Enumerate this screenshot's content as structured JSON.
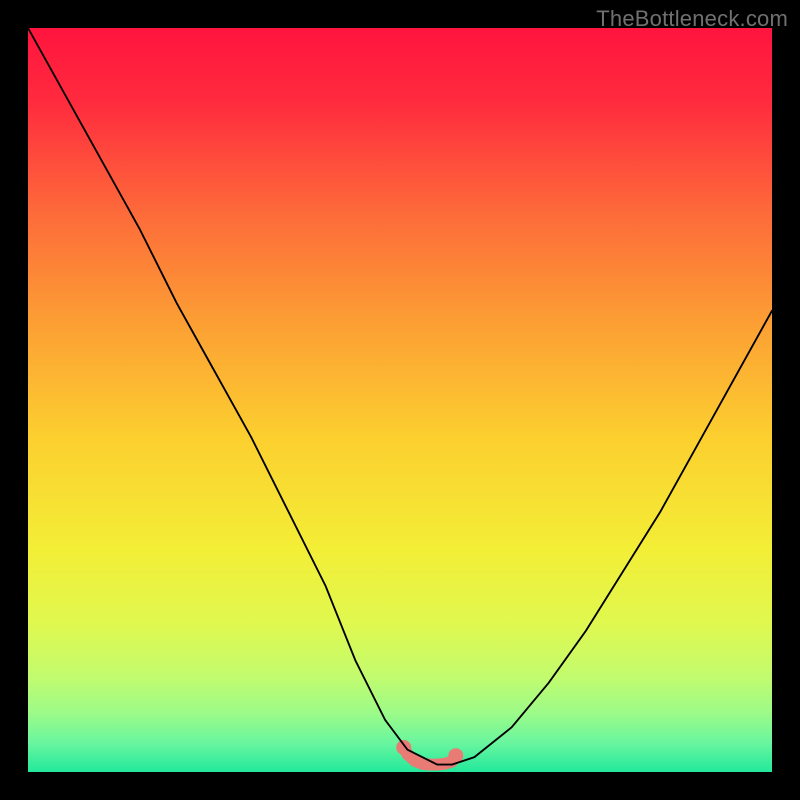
{
  "watermark": "TheBottleneck.com",
  "chart_data": {
    "type": "line",
    "title": "",
    "xlabel": "",
    "ylabel": "",
    "xlim": [
      0,
      100
    ],
    "ylim": [
      0,
      100
    ],
    "grid": false,
    "legend": false,
    "series": [
      {
        "name": "curve",
        "color": "#000000",
        "x": [
          0,
          5,
          10,
          15,
          20,
          25,
          30,
          35,
          40,
          44,
          48,
          51,
          55,
          57,
          60,
          65,
          70,
          75,
          80,
          85,
          90,
          95,
          100
        ],
        "values": [
          100,
          91,
          82,
          73,
          63,
          54,
          45,
          35,
          25,
          15,
          7,
          3,
          1,
          1,
          2,
          6,
          12,
          19,
          27,
          35,
          44,
          53,
          62
        ]
      },
      {
        "name": "threshold-band",
        "color": "#e87b74",
        "x": [
          50.5,
          51,
          52,
          53,
          54,
          55,
          56,
          57,
          57.5
        ],
        "values": [
          3.3,
          2.4,
          1.5,
          1.1,
          1.0,
          1.0,
          1.1,
          1.4,
          2.2
        ]
      }
    ],
    "gradient_stops": [
      {
        "pos": 0.0,
        "color": "#ff143e"
      },
      {
        "pos": 0.1,
        "color": "#ff2b3e"
      },
      {
        "pos": 0.25,
        "color": "#fd6b3a"
      },
      {
        "pos": 0.4,
        "color": "#fca034"
      },
      {
        "pos": 0.55,
        "color": "#fccf2f"
      },
      {
        "pos": 0.7,
        "color": "#f3ee36"
      },
      {
        "pos": 0.8,
        "color": "#e0f84f"
      },
      {
        "pos": 0.87,
        "color": "#c3fb6d"
      },
      {
        "pos": 0.92,
        "color": "#9dfb88"
      },
      {
        "pos": 0.96,
        "color": "#6af69e"
      },
      {
        "pos": 1.0,
        "color": "#22e89c"
      }
    ]
  }
}
